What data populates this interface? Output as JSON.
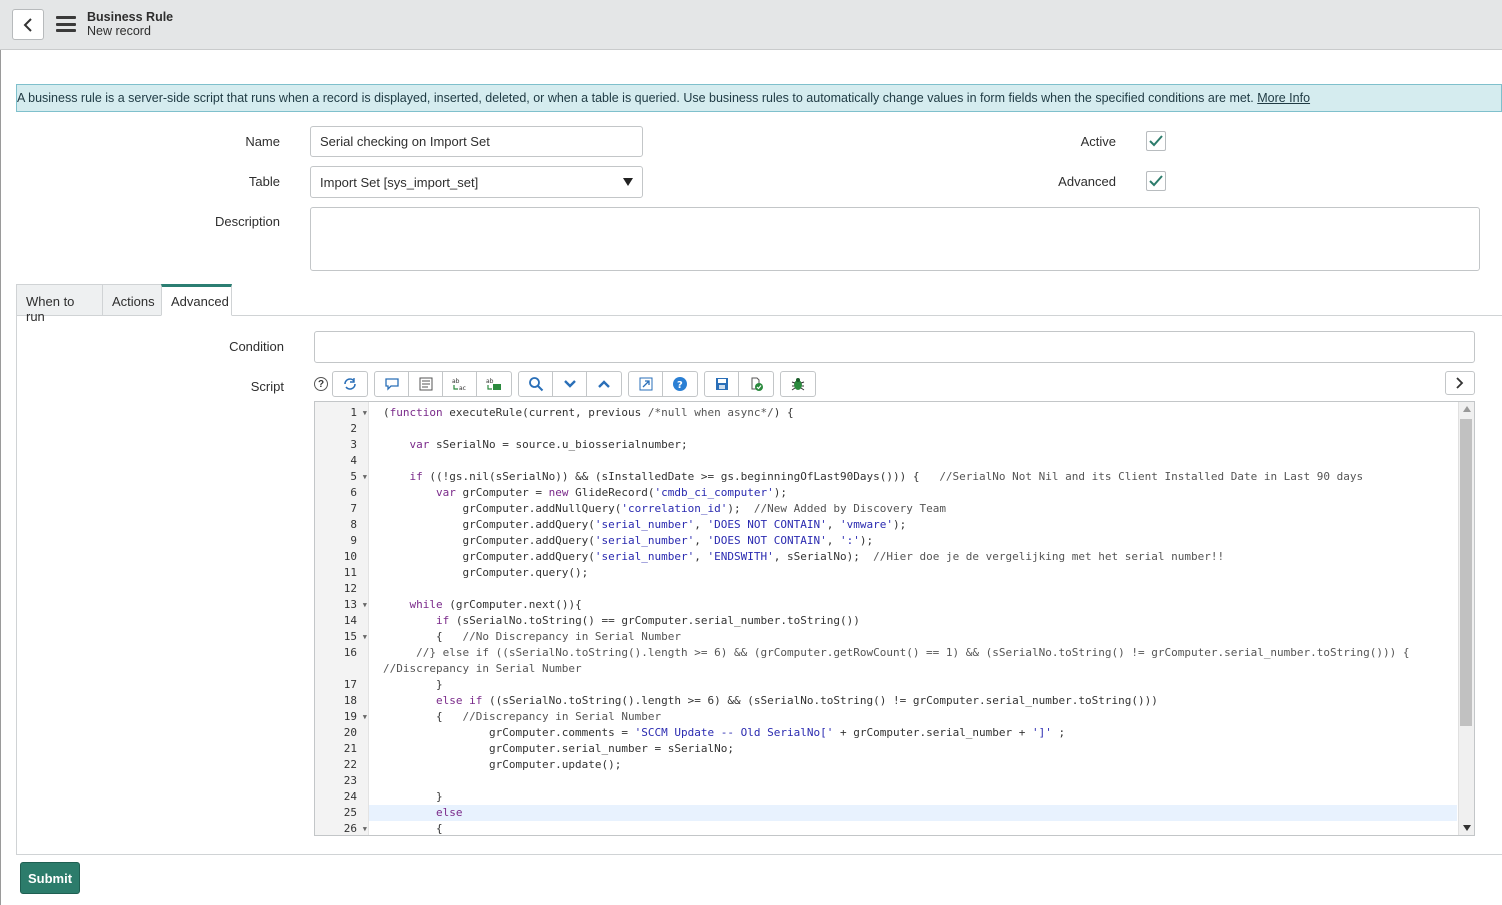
{
  "header": {
    "title": "Business Rule",
    "subtitle": "New record"
  },
  "info": {
    "text": "A business rule is a server-side script that runs when a record is displayed, inserted, deleted, or when a table is queried. Use business rules to automatically change values in form fields when the specified conditions are met. ",
    "link": "More Info"
  },
  "form": {
    "name_label": "Name",
    "name_value": "Serial checking on Import Set",
    "table_label": "Table",
    "table_value": "Import Set [sys_import_set]",
    "description_label": "Description",
    "active_label": "Active",
    "active": true,
    "advanced_label": "Advanced",
    "advanced": true,
    "condition_label": "Condition",
    "script_label": "Script"
  },
  "tabs": [
    "When to run",
    "Actions",
    "Advanced"
  ],
  "active_tab": "Advanced",
  "toolbar": {
    "icons": [
      "help-icon",
      "sync-icon",
      "comment-icon",
      "format-icon",
      "replace-icon",
      "replace-all-icon",
      "search-icon",
      "find-next-icon",
      "find-previous-icon",
      "fullscreen-icon",
      "help-circle-icon",
      "save-icon",
      "script-check-icon",
      "debug-icon"
    ]
  },
  "colors": {
    "accent": "#2c7c6b",
    "info_bg": "#d5ecef",
    "header_bg": "#e4e6e7"
  },
  "code_lines": [
    {
      "n": "1",
      "fold": true,
      "t": "(function executeRule(current, previous /*null when async*/) {"
    },
    {
      "n": "2",
      "fold": false,
      "t": ""
    },
    {
      "n": "3",
      "fold": false,
      "t": "    var sSerialNo = source.u_biosserialnumber;"
    },
    {
      "n": "4",
      "fold": false,
      "t": ""
    },
    {
      "n": "5",
      "fold": true,
      "t": "    if ((!gs.nil(sSerialNo)) && (sInstalledDate >= gs.beginningOfLast90Days())) {   //SerialNo Not Nil and its Client Installed Date in Last 90 days"
    },
    {
      "n": "6",
      "fold": false,
      "t": "        var grComputer = new GlideRecord('cmdb_ci_computer');"
    },
    {
      "n": "7",
      "fold": false,
      "t": "            grComputer.addNullQuery('correlation_id');  //New Added by Discovery Team"
    },
    {
      "n": "8",
      "fold": false,
      "t": "            grComputer.addQuery('serial_number', 'DOES NOT CONTAIN', 'vmware');"
    },
    {
      "n": "9",
      "fold": false,
      "t": "            grComputer.addQuery('serial_number', 'DOES NOT CONTAIN', ':');"
    },
    {
      "n": "10",
      "fold": false,
      "t": "            grComputer.addQuery('serial_number', 'ENDSWITH', sSerialNo);  //Hier doe je de vergelijking met het serial number!!"
    },
    {
      "n": "11",
      "fold": false,
      "t": "            grComputer.query();"
    },
    {
      "n": "12",
      "fold": false,
      "t": ""
    },
    {
      "n": "13",
      "fold": true,
      "t": "    while (grComputer.next()){"
    },
    {
      "n": "14",
      "fold": false,
      "t": "        if (sSerialNo.toString() == grComputer.serial_number.toString())"
    },
    {
      "n": "15",
      "fold": true,
      "t": "        {   //No Discrepancy in Serial Number"
    },
    {
      "n": "16",
      "fold": false,
      "t": "     //} else if ((sSerialNo.toString().length >= 6) && (grComputer.getRowCount() == 1) && (sSerialNo.toString() != grComputer.serial_number.toString())) {"
    },
    {
      "n": "",
      "fold": false,
      "t": "//Discrepancy in Serial Number"
    },
    {
      "n": "17",
      "fold": false,
      "t": "        }"
    },
    {
      "n": "18",
      "fold": false,
      "t": "        else if ((sSerialNo.toString().length >= 6) && (sSerialNo.toString() != grComputer.serial_number.toString()))"
    },
    {
      "n": "19",
      "fold": true,
      "t": "        {   //Discrepancy in Serial Number"
    },
    {
      "n": "20",
      "fold": false,
      "t": "                grComputer.comments = 'SCCM Update -- Old SerialNo[' + grComputer.serial_number + ']' ;"
    },
    {
      "n": "21",
      "fold": false,
      "t": "                grComputer.serial_number = sSerialNo;"
    },
    {
      "n": "22",
      "fold": false,
      "t": "                grComputer.update();"
    },
    {
      "n": "23",
      "fold": false,
      "t": ""
    },
    {
      "n": "24",
      "fold": false,
      "t": "        }"
    },
    {
      "n": "25",
      "fold": false,
      "t": "        else"
    },
    {
      "n": "26",
      "fold": true,
      "t": "        {"
    }
  ],
  "highlighted_line": "25",
  "submit_label": "Submit"
}
